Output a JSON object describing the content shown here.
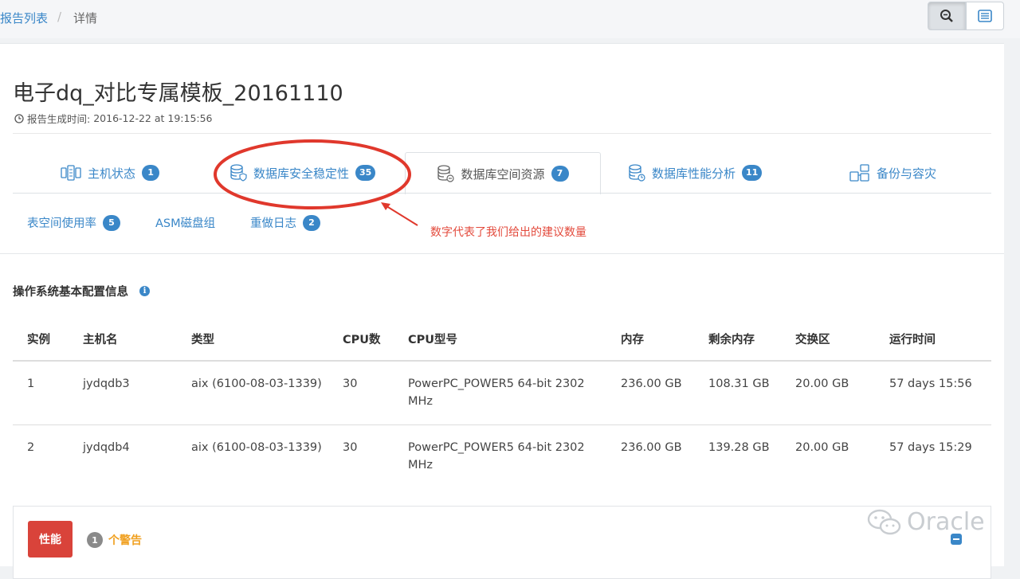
{
  "breadcrumb": {
    "parent": "报告列表",
    "separator": "/",
    "current": "详情"
  },
  "toolbar": {
    "zoom_icon": "zoom-icon",
    "list_icon": "list-icon"
  },
  "report": {
    "title": "电子dq_对比专属模板_20161110",
    "generated_label": "报告生成时间:",
    "generated_time": "2016-12-22 at 19:15:56"
  },
  "tabs": [
    {
      "label": "主机状态",
      "badge": "1",
      "icon": "server-icon"
    },
    {
      "label": "数据库安全稳定性",
      "badge": "35",
      "icon": "database-shield-icon"
    },
    {
      "label": "数据库空间资源",
      "badge": "7",
      "icon": "database-icon",
      "active": true
    },
    {
      "label": "数据库性能分析",
      "badge": "11",
      "icon": "database-chart-icon"
    },
    {
      "label": "备份与容灾",
      "badge": "",
      "icon": "backup-icon"
    }
  ],
  "subtabs": [
    {
      "label": "表空间使用率",
      "badge": "5"
    },
    {
      "label": "ASM磁盘组",
      "badge": ""
    },
    {
      "label": "重做日志",
      "badge": "2"
    }
  ],
  "annotation": {
    "text": "数字代表了我们给出的建议数量",
    "color": "#e34a3c"
  },
  "section": {
    "title": "操作系统基本配置信息",
    "info_icon": "i"
  },
  "table": {
    "headers": [
      "实例",
      "主机名",
      "类型",
      "CPU数",
      "CPU型号",
      "内存",
      "剩余内存",
      "交换区",
      "运行时间"
    ],
    "rows": [
      [
        "1",
        "jydqdb3",
        "aix (6100-08-03-1339)",
        "30",
        "PowerPC_POWER5 64-bit 2302 MHz",
        "236.00 GB",
        "108.31 GB",
        "20.00 GB",
        "57 days 15:56"
      ],
      [
        "2",
        "jydqdb4",
        "aix (6100-08-03-1339)",
        "30",
        "PowerPC_POWER5 64-bit 2302 MHz",
        "236.00 GB",
        "139.28 GB",
        "20.00 GB",
        "57 days 15:29"
      ]
    ]
  },
  "performance": {
    "button": "性能",
    "warning_count": "1",
    "warning_label": "个警告"
  },
  "watermark": "Oracle",
  "colors": {
    "accent": "#3a87c8",
    "danger": "#d9433a",
    "warning": "#f0a020"
  }
}
